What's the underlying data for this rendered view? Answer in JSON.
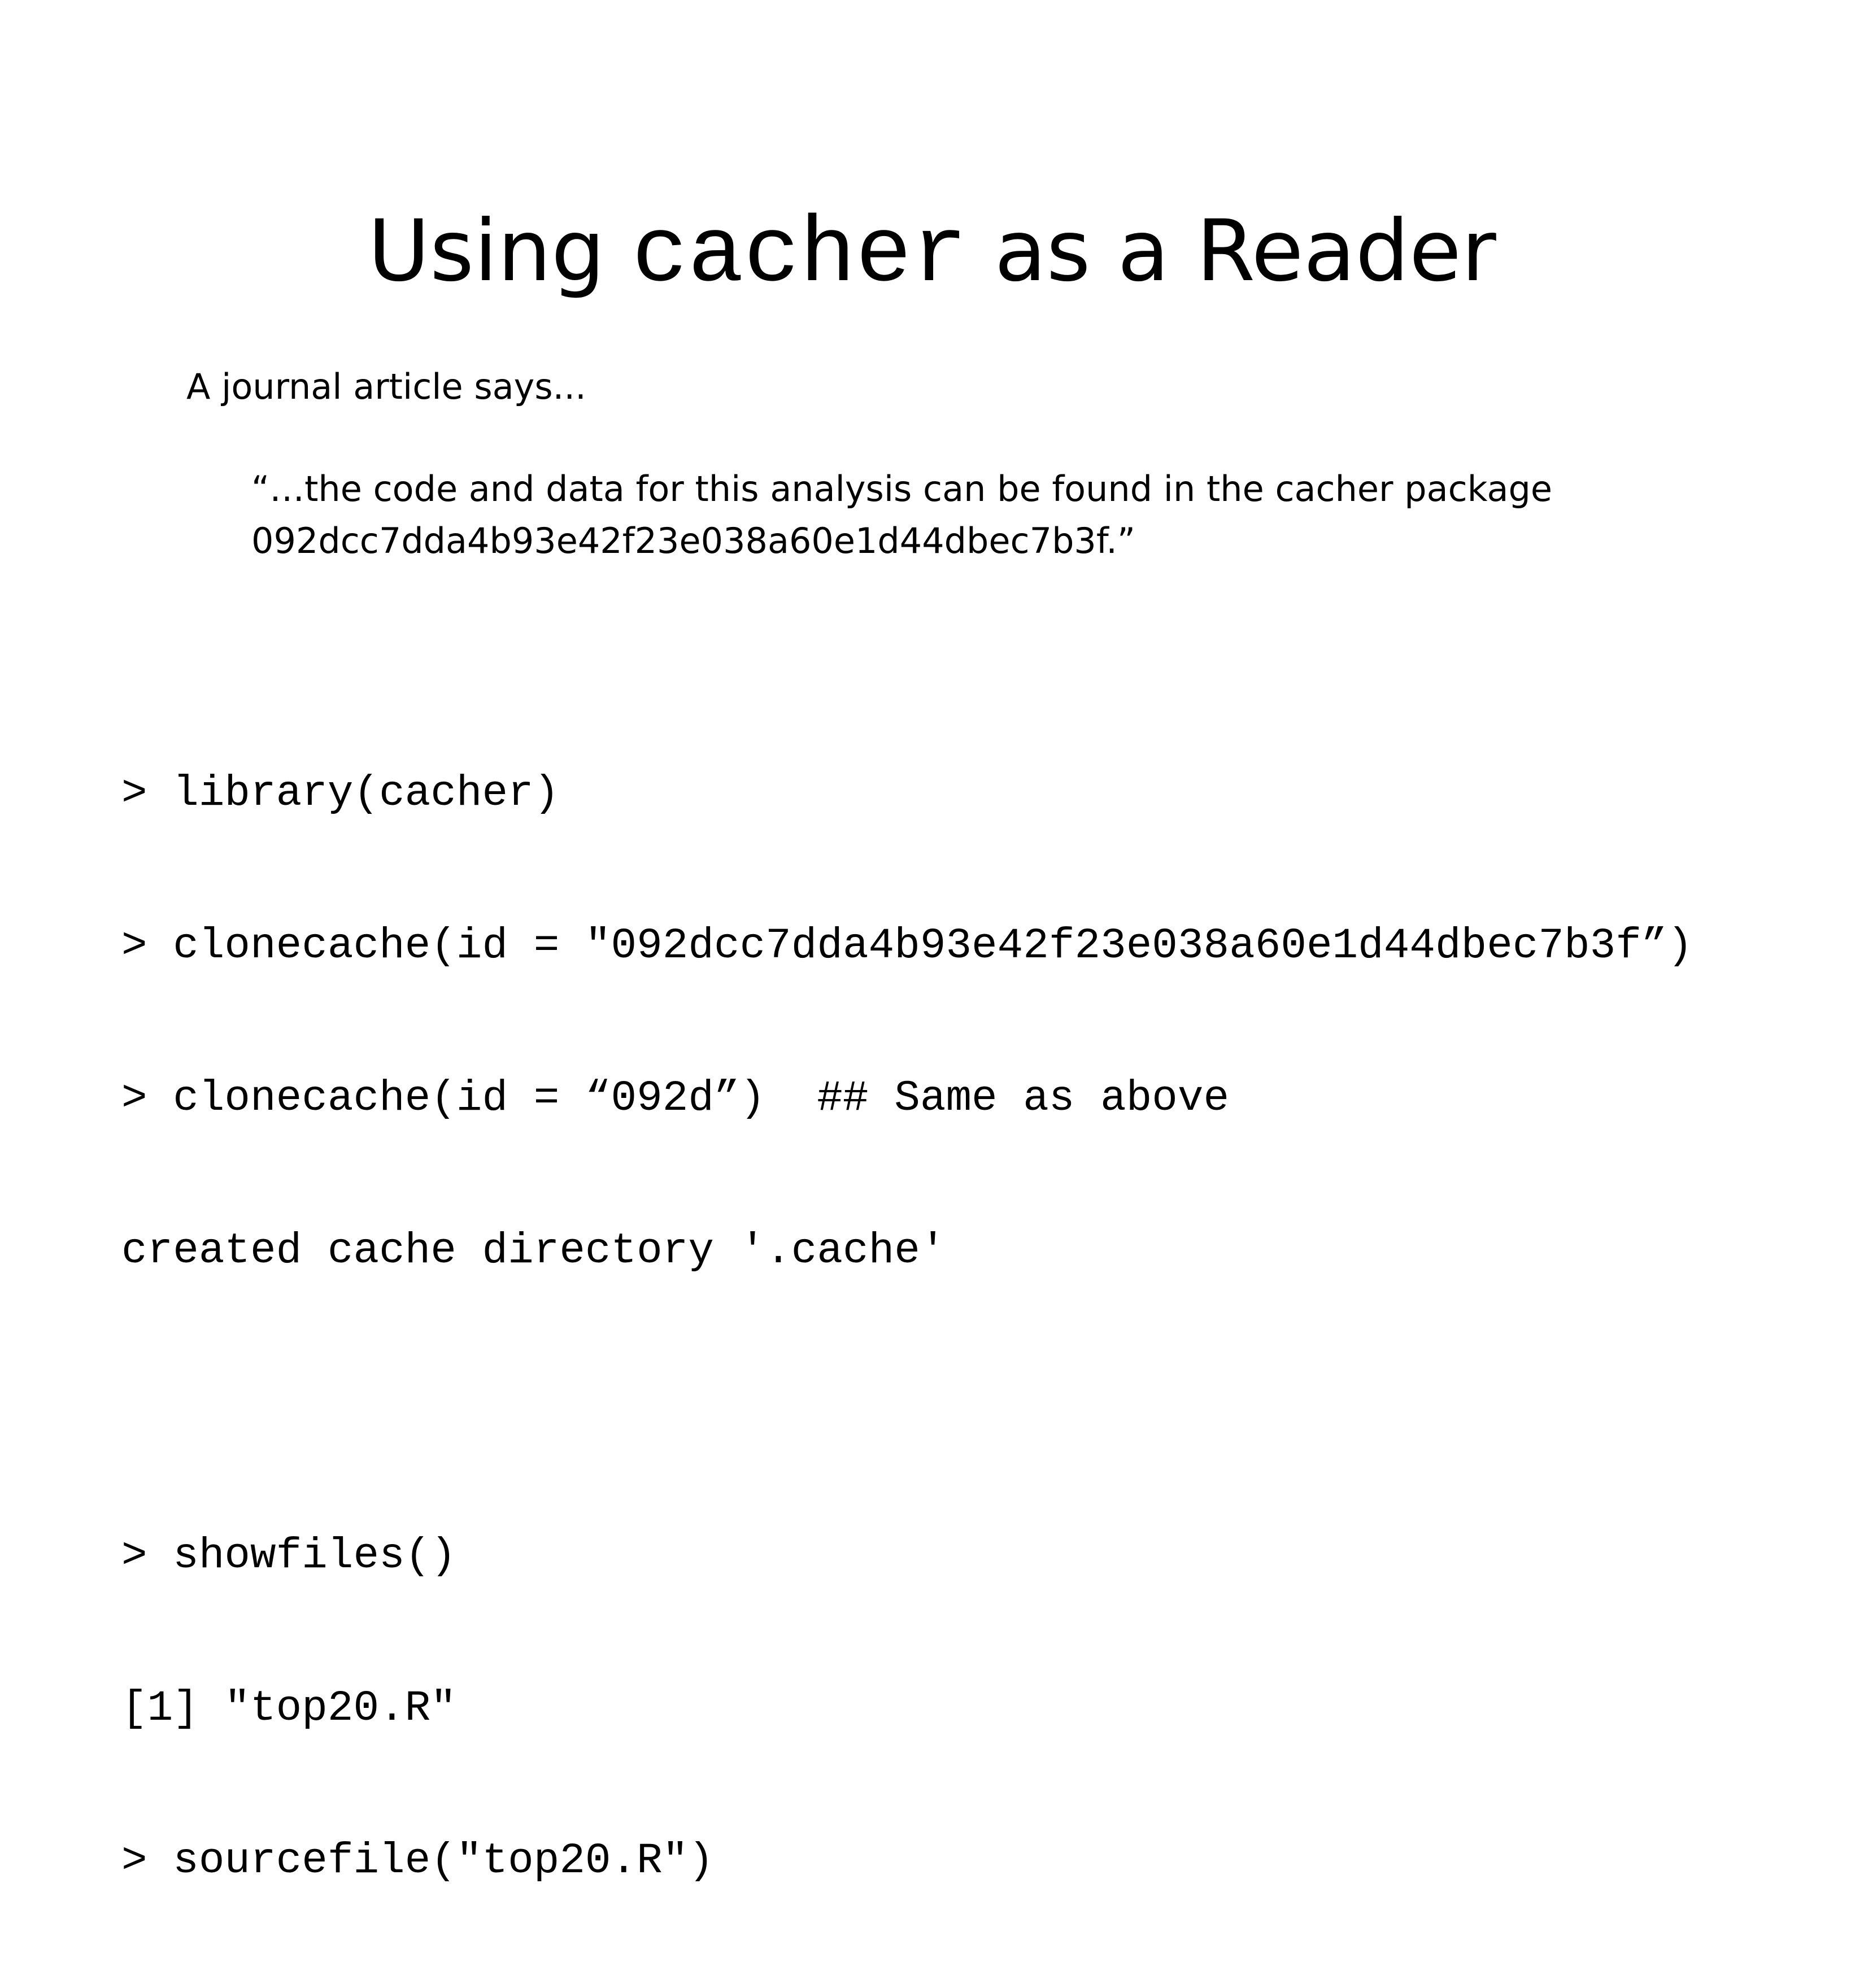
{
  "slide": {
    "title": {
      "before": "Using ",
      "code": "cacher",
      "after": " as a Reader"
    },
    "intro": "A journal article says...",
    "quote": {
      "line1": "“…the code and data for this analysis can be found in the cacher package",
      "line2": "092dcc7dda4b93e42f23e038a60e1d44dbec7b3f.”"
    },
    "code_lines": {
      "l1": "> library(cacher)",
      "l2": "> clonecache(id = \"092dcc7dda4b93e42f23e038a60e1d44dbec7b3f”)",
      "l3": "> clonecache(id = “092d”)  ## Same as above",
      "l4": "created cache directory '.cache'",
      "l5": "> showfiles()",
      "l6": "[1] \"top20.R\"",
      "l7": "> sourcefile(\"top20.R\")"
    }
  }
}
